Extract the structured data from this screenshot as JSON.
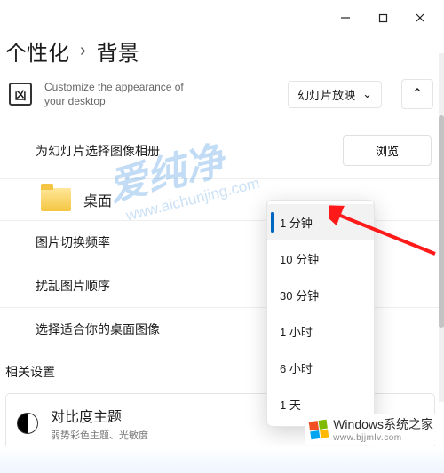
{
  "titlebar": {
    "min": "—",
    "max": "❐",
    "close": "✕"
  },
  "breadcrumb": {
    "parent": "个性化",
    "sep": "›",
    "current": "背景"
  },
  "subhead": {
    "icon": "凶",
    "text": "Customize the appearance of your desktop",
    "dropdown": "幻灯片放映"
  },
  "rows": {
    "album": "为幻灯片选择图像相册",
    "browse": "浏览",
    "desktop": "桌面",
    "freq": "图片切换频率",
    "shuffle": "扰乱图片顺序",
    "fit": "选择适合你的桌面图像"
  },
  "related": "相关设置",
  "contrast": {
    "title": "对比度主题",
    "sub": "弱势彩色主题、光敏度"
  },
  "dropdown_items": [
    "1 分钟",
    "10 分钟",
    "30 分钟",
    "1 小时",
    "6 小时",
    "1 天"
  ],
  "badge": {
    "brand": "Windows",
    "tag": "系统之家",
    "url": "www.bjjmlv.com"
  },
  "watermark": {
    "main": "爱纯净",
    "sub": "www.aichunjing.com"
  }
}
